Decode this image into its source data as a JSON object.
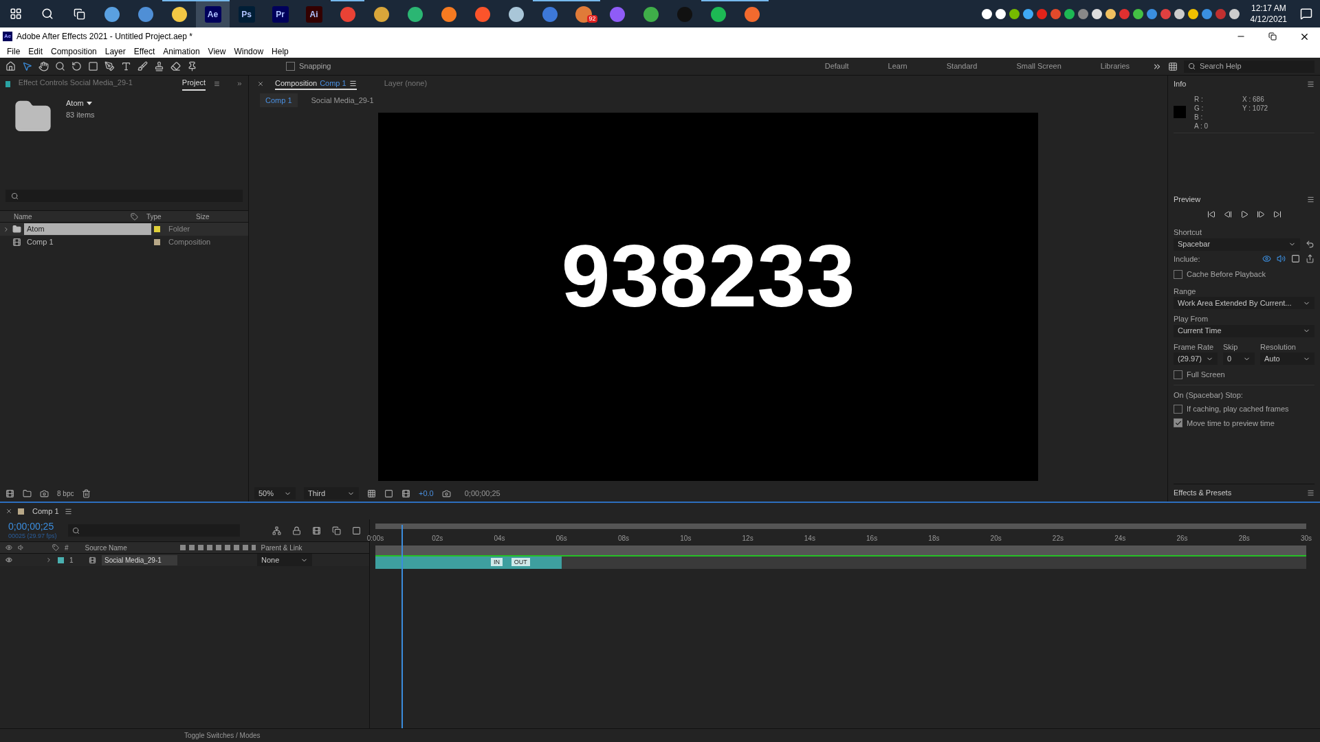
{
  "taskbar": {
    "apps": [
      {
        "kind": "glyph",
        "color": "#5aa0e0",
        "running": false
      },
      {
        "kind": "glyph",
        "color": "#4f8fd6",
        "running": false
      },
      {
        "kind": "glyph",
        "color": "#f2c744",
        "running": true
      },
      {
        "kind": "letters",
        "label": "Ae",
        "color": "#00005b",
        "running": true,
        "selected": true
      },
      {
        "kind": "letters",
        "label": "Ps",
        "color": "#001e36",
        "running": false,
        "selected": false
      },
      {
        "kind": "letters",
        "label": "Pr",
        "color": "#00005b",
        "running": false,
        "selected": false
      },
      {
        "kind": "letters",
        "label": "Ai",
        "color": "#330000",
        "running": false,
        "selected": false
      },
      {
        "kind": "glyph",
        "color": "#e94235",
        "running": true
      },
      {
        "kind": "glyph",
        "color": "#d9a63a",
        "running": false
      },
      {
        "kind": "glyph",
        "color": "#2bb673",
        "running": false
      },
      {
        "kind": "glyph",
        "color": "#f57a21",
        "running": false
      },
      {
        "kind": "glyph",
        "color": "#fb542b",
        "running": false
      },
      {
        "kind": "glyph",
        "color": "#a9c6d8",
        "running": false
      },
      {
        "kind": "glyph",
        "color": "#3d78d8",
        "running": true
      },
      {
        "kind": "badge",
        "label": "92",
        "color": "#e07b39",
        "running": true
      },
      {
        "kind": "glyph",
        "color": "#8f5cf7",
        "running": false
      },
      {
        "kind": "glyph",
        "color": "#3fae49",
        "running": false
      },
      {
        "kind": "glyph",
        "color": "#111111",
        "running": false
      },
      {
        "kind": "glyph",
        "color": "#1db954",
        "running": true
      },
      {
        "kind": "glyph",
        "color": "#f26a2e",
        "running": true
      }
    ],
    "time": "12:17 AM",
    "date": "4/12/2021"
  },
  "window": {
    "title": "Adobe After Effects 2021 - Untitled Project.aep *",
    "app_badge": "Ae"
  },
  "menu": [
    "File",
    "Edit",
    "Composition",
    "Layer",
    "Effect",
    "Animation",
    "View",
    "Window",
    "Help"
  ],
  "toolbar": {
    "snapping": {
      "label": "Snapping",
      "checked": false
    },
    "workspaces": [
      "Default",
      "Learn",
      "Standard",
      "Small Screen",
      "Libraries"
    ],
    "search": {
      "placeholder": "Search Help"
    }
  },
  "project_panel": {
    "tabs": [
      {
        "label": "Effect Controls",
        "sub": "Social Media_29-1",
        "selected": false
      },
      {
        "label": "Project",
        "selected": true
      }
    ],
    "folder": {
      "name": "Atom",
      "count": "83 items"
    },
    "columns": [
      "Name",
      "Type",
      "Size"
    ],
    "rows": [
      {
        "name": "Atom",
        "kind": "folder",
        "type": "Folder",
        "color": "#e0d03a",
        "selected": true
      },
      {
        "name": "Comp 1",
        "kind": "composition",
        "type": "Composition",
        "color": "#b8a888",
        "selected": false
      }
    ],
    "bpc": "8 bpc"
  },
  "viewer": {
    "tabs": [
      {
        "label": "Composition",
        "name": "Comp 1",
        "selected": true
      },
      {
        "label": "Layer (none)",
        "selected": false
      }
    ],
    "breadcrumbs": [
      {
        "label": "Comp 1",
        "selected": true
      },
      {
        "label": "Social Media_29-1",
        "selected": false
      }
    ],
    "canvas_text": "938233",
    "zoom": "50%",
    "resolution": "Third",
    "exposure": "+0.0",
    "timecode": "0;00;00;25"
  },
  "info": {
    "title": "Info",
    "channels": [
      "R :",
      "G :",
      "B :",
      "A : 0"
    ],
    "coords": [
      "X : 686",
      "Y : 1072"
    ]
  },
  "preview": {
    "title": "Preview",
    "shortcut_label": "Shortcut",
    "shortcut": "Spacebar",
    "include_label": "Include:",
    "include": {
      "video": true,
      "audio": true,
      "overlay": false
    },
    "cache": {
      "label": "Cache Before Playback",
      "checked": false
    },
    "range_label": "Range",
    "range": "Work Area Extended By Current...",
    "play_from_label": "Play From",
    "play_from": "Current Time",
    "fields": [
      {
        "label": "Frame Rate",
        "value": "(29.97)"
      },
      {
        "label": "Skip",
        "value": "0"
      },
      {
        "label": "Resolution",
        "value": "Auto"
      }
    ],
    "full_screen": {
      "label": "Full Screen",
      "checked": false
    },
    "stop_label": "On (Spacebar) Stop:",
    "stop_options": [
      {
        "label": "If caching, play cached frames",
        "checked": false
      },
      {
        "label": "Move time to preview time",
        "checked": true
      }
    ]
  },
  "effects": {
    "title": "Effects & Presets"
  },
  "timeline": {
    "tab": "Comp 1",
    "timecode": "0;00;00;25",
    "frames": "00025 (29.97 fps)",
    "columns": [
      "#",
      "Source Name",
      "Parent & Link"
    ],
    "ticks": [
      "0:00s",
      "02s",
      "04s",
      "06s",
      "08s",
      "10s",
      "12s",
      "14s",
      "16s",
      "18s",
      "20s",
      "22s",
      "24s",
      "26s",
      "28s",
      "30s"
    ],
    "playhead": {
      "level": 0.028
    },
    "layers": [
      {
        "index": "1",
        "name": "Social Media_29-1",
        "parent": "None",
        "visible": true,
        "color": "#4ab0b0",
        "bar": {
          "level": 0.2
        },
        "markers": [
          {
            "label": "IN",
            "level": 0.124
          },
          {
            "label": "OUT",
            "level": 0.146
          }
        ]
      }
    ],
    "toggle": "Toggle Switches / Modes"
  }
}
